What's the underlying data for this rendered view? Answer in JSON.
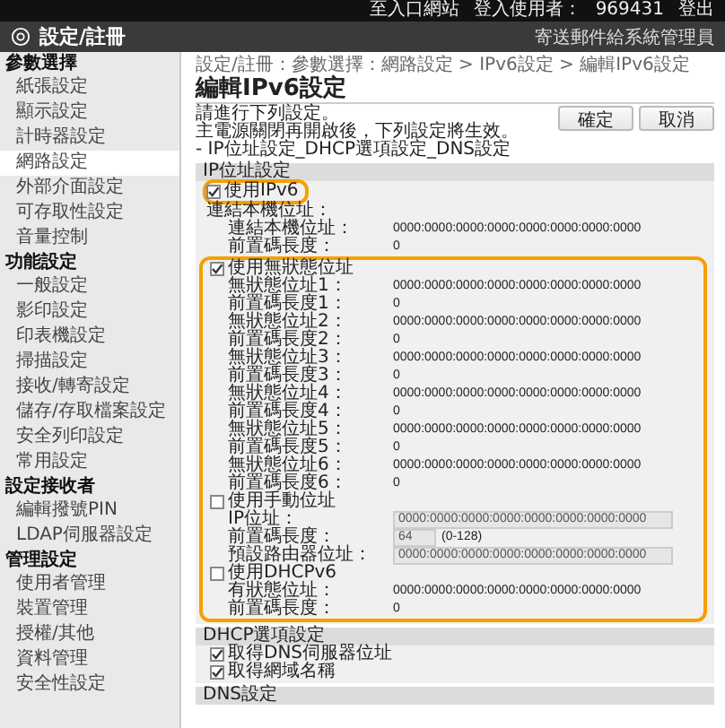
{
  "top_bar": {
    "portal_link": "至入口網站",
    "user_label": "登入使用者：",
    "user_name": "969431",
    "logout": "登出"
  },
  "header": {
    "title": "設定/註冊",
    "mail_link": "寄送郵件給系統管理員"
  },
  "sidebar": [
    {
      "heading": "參數選擇",
      "items": [
        {
          "label": "紙張設定",
          "selected": false
        },
        {
          "label": "顯示設定",
          "selected": false
        },
        {
          "label": "計時器設定",
          "selected": false
        },
        {
          "label": "網路設定",
          "selected": true
        },
        {
          "label": "外部介面設定",
          "selected": false
        },
        {
          "label": "可存取性設定",
          "selected": false
        },
        {
          "label": "音量控制",
          "selected": false
        }
      ]
    },
    {
      "heading": "功能設定",
      "items": [
        {
          "label": "一般設定",
          "selected": false
        },
        {
          "label": "影印設定",
          "selected": false
        },
        {
          "label": "印表機設定",
          "selected": false
        },
        {
          "label": "掃描設定",
          "selected": false
        },
        {
          "label": "接收/轉寄設定",
          "selected": false
        },
        {
          "label": "儲存/存取檔案設定",
          "selected": false
        },
        {
          "label": "安全列印設定",
          "selected": false
        },
        {
          "label": "常用設定",
          "selected": false
        }
      ]
    },
    {
      "heading": "設定接收者",
      "items": [
        {
          "label": "編輯撥號PIN",
          "selected": false
        },
        {
          "label": "LDAP伺服器設定",
          "selected": false
        }
      ]
    },
    {
      "heading": "管理設定",
      "items": [
        {
          "label": "使用者管理",
          "selected": false
        },
        {
          "label": "裝置管理",
          "selected": false
        },
        {
          "label": "授權/其他",
          "selected": false
        },
        {
          "label": "資料管理",
          "selected": false
        },
        {
          "label": "安全性設定",
          "selected": false
        }
      ]
    }
  ],
  "breadcrumb": "設定/註冊：參數選擇：網路設定 > IPv6設定 > 編輯IPv6設定",
  "page_title": "編輯IPv6設定",
  "instructions": [
    "請進行下列設定。",
    "主電源關閉再開啟後，下列設定將生效。",
    "- IP位址設定_DHCP選項設定_DNS設定"
  ],
  "buttons": [
    "確定",
    "取消"
  ],
  "sections": [
    {
      "title": "IP位址設定",
      "rows": [
        {
          "kind": "checkbox",
          "label": "使用IPv6",
          "checked": true,
          "highlighted": true
        },
        {
          "kind": "heading",
          "label": "連結本機位址：",
          "rows": [
            {
              "kind": "value",
              "label": "連結本機位址：",
              "value": "0000:0000:0000:0000:0000:0000:0000:0000"
            },
            {
              "kind": "value",
              "label": "前置碼長度：",
              "value": "0"
            }
          ]
        },
        {
          "kind": "group",
          "highlighted": true,
          "rows": [
            {
              "kind": "checkbox",
              "label": "使用無狀態位址",
              "checked": true,
              "highlighted": false,
              "rows": [
                {
                  "kind": "value",
                  "label": "無狀態位址1：",
                  "value": "0000:0000:0000:0000:0000:0000:0000:0000"
                },
                {
                  "kind": "value",
                  "label": "前置碼長度1：",
                  "value": "0"
                },
                {
                  "kind": "value",
                  "label": "無狀態位址2：",
                  "value": "0000:0000:0000:0000:0000:0000:0000:0000"
                },
                {
                  "kind": "value",
                  "label": "前置碼長度2：",
                  "value": "0"
                },
                {
                  "kind": "value",
                  "label": "無狀態位址3：",
                  "value": "0000:0000:0000:0000:0000:0000:0000:0000"
                },
                {
                  "kind": "value",
                  "label": "前置碼長度3：",
                  "value": "0"
                },
                {
                  "kind": "value",
                  "label": "無狀態位址4：",
                  "value": "0000:0000:0000:0000:0000:0000:0000:0000"
                },
                {
                  "kind": "value",
                  "label": "前置碼長度4：",
                  "value": "0"
                },
                {
                  "kind": "value",
                  "label": "無狀態位址5：",
                  "value": "0000:0000:0000:0000:0000:0000:0000:0000"
                },
                {
                  "kind": "value",
                  "label": "前置碼長度5：",
                  "value": "0"
                },
                {
                  "kind": "value",
                  "label": "無狀態位址6：",
                  "value": "0000:0000:0000:0000:0000:0000:0000:0000"
                },
                {
                  "kind": "value",
                  "label": "前置碼長度6：",
                  "value": "0"
                }
              ]
            },
            {
              "kind": "checkbox",
              "label": "使用手動位址",
              "checked": false,
              "highlighted": false,
              "rows": [
                {
                  "kind": "field",
                  "label": "IP位址：",
                  "value": "0000:0000:0000:0000:0000:0000:0000:0000",
                  "disabled": true
                },
                {
                  "kind": "field",
                  "label": "前置碼長度：",
                  "value": "64",
                  "hint": "(0-128)",
                  "disabled": true
                },
                {
                  "kind": "field",
                  "label": "預設路由器位址：",
                  "value": "0000:0000:0000:0000:0000:0000:0000:0000",
                  "disabled": true
                }
              ]
            },
            {
              "kind": "checkbox",
              "label": "使用DHCPv6",
              "checked": false,
              "highlighted": false,
              "rows": [
                {
                  "kind": "value",
                  "label": "有狀態位址：",
                  "value": "0000:0000:0000:0000:0000:0000:0000:0000"
                },
                {
                  "kind": "value",
                  "label": "前置碼長度：",
                  "value": "0"
                }
              ]
            }
          ]
        }
      ]
    },
    {
      "title": "DHCP選項設定",
      "rows": [
        {
          "kind": "checkbox",
          "label": "取得DNS伺服器位址",
          "checked": true,
          "highlighted": false
        },
        {
          "kind": "checkbox",
          "label": "取得網域名稱",
          "checked": true,
          "highlighted": false
        }
      ]
    },
    {
      "title": "DNS設定"
    }
  ]
}
